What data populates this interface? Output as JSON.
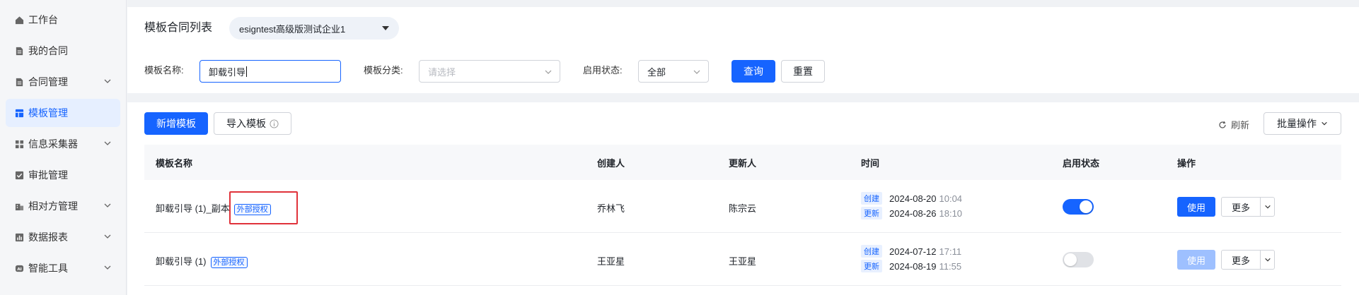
{
  "sidebar": {
    "items": [
      {
        "label": "工作台",
        "icon": "home-icon"
      },
      {
        "label": "我的合同",
        "icon": "document-icon"
      },
      {
        "label": "合同管理",
        "icon": "document-icon",
        "expandable": true
      },
      {
        "label": "模板管理",
        "icon": "template-icon",
        "active": true
      },
      {
        "label": "信息采集器",
        "icon": "grid-icon",
        "expandable": true
      },
      {
        "label": "审批管理",
        "icon": "checkbox-icon"
      },
      {
        "label": "相对方管理",
        "icon": "building-icon",
        "expandable": true
      },
      {
        "label": "数据报表",
        "icon": "bar-chart-icon",
        "expandable": true
      },
      {
        "label": "智能工具",
        "icon": "ai-icon",
        "expandable": true
      }
    ]
  },
  "header": {
    "title": "模板合同列表",
    "org": "esigntest高级版测试企业1"
  },
  "filters": {
    "name_label": "模板名称:",
    "name_value": "卸载引导",
    "category_label": "模板分类:",
    "category_placeholder": "请选择",
    "status_label": "启用状态:",
    "status_value": "全部",
    "query_label": "查询",
    "reset_label": "重置"
  },
  "toolbar": {
    "add_label": "新增模板",
    "import_label": "导入模板",
    "refresh_label": "刷新",
    "batch_label": "批量操作"
  },
  "table": {
    "columns": [
      "模板名称",
      "创建人",
      "更新人",
      "时间",
      "启用状态",
      "操作"
    ],
    "rows": [
      {
        "name": "卸载引导 (1)_副本",
        "tag": "外部授权",
        "creator": "乔林飞",
        "updater": "陈宗云",
        "created_label": "创建",
        "created_date": "2024-08-20",
        "created_time": "10:04",
        "updated_label": "更新",
        "updated_date": "2024-08-26",
        "updated_time": "18:10",
        "enabled": true,
        "use_label": "使用",
        "more_label": "更多"
      },
      {
        "name": "卸载引导 (1)",
        "tag": "外部授权",
        "creator": "王亚星",
        "updater": "王亚星",
        "created_label": "创建",
        "created_date": "2024-07-12",
        "created_time": "17:11",
        "updated_label": "更新",
        "updated_date": "2024-08-19",
        "updated_time": "11:55",
        "enabled": false,
        "use_label": "使用",
        "more_label": "更多"
      }
    ]
  },
  "colors": {
    "primary": "#1664ff",
    "highlight": "#e0323a"
  }
}
